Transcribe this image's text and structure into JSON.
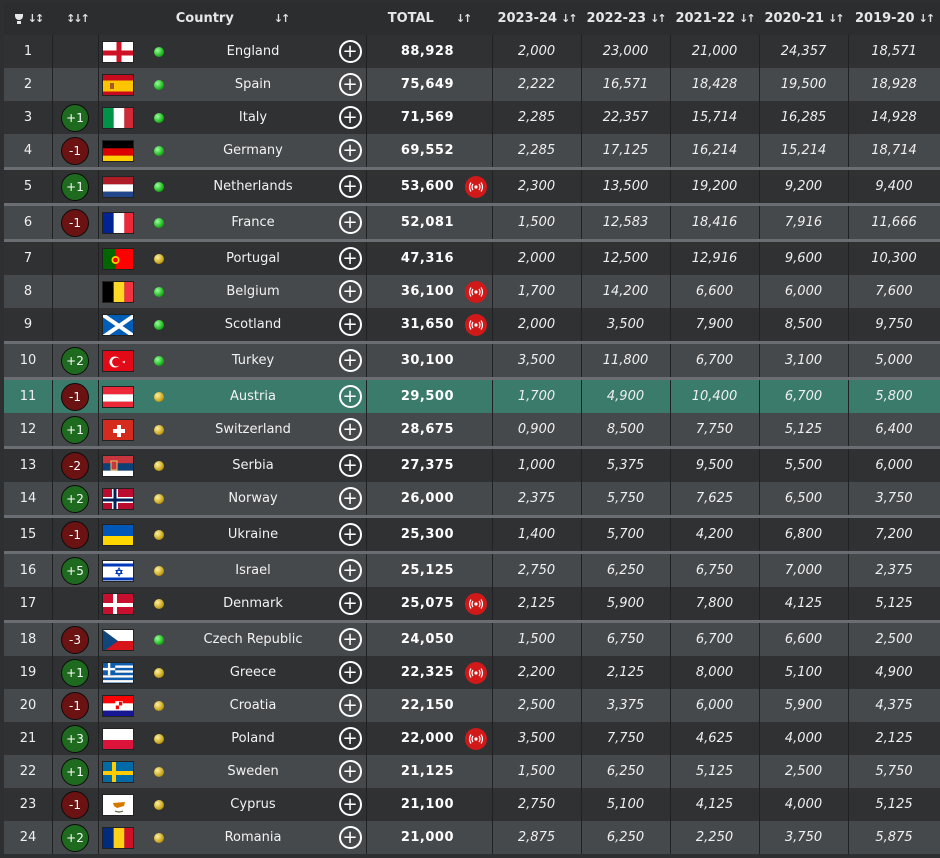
{
  "header": {
    "country": "Country",
    "total": "TOTAL",
    "seasons": [
      "2023-24",
      "2022-23",
      "2021-22",
      "2020-21",
      "2019-20"
    ]
  },
  "rows": [
    {
      "rank": "1",
      "change": "",
      "flag": "england",
      "status": "green",
      "country": "England",
      "total": "88,928",
      "live": false,
      "seasons": [
        "2,000",
        "23,000",
        "21,000",
        "24,357",
        "18,571"
      ]
    },
    {
      "rank": "2",
      "change": "",
      "flag": "spain",
      "status": "green",
      "country": "Spain",
      "total": "75,649",
      "live": false,
      "seasons": [
        "2,222",
        "16,571",
        "18,428",
        "19,500",
        "18,928"
      ]
    },
    {
      "rank": "3",
      "change": "+1",
      "flag": "italy",
      "status": "green",
      "country": "Italy",
      "total": "71,569",
      "live": false,
      "seasons": [
        "2,285",
        "22,357",
        "15,714",
        "16,285",
        "14,928"
      ]
    },
    {
      "rank": "4",
      "change": "-1",
      "flag": "germany",
      "status": "green",
      "country": "Germany",
      "total": "69,552",
      "live": false,
      "seasons": [
        "2,285",
        "17,125",
        "16,214",
        "15,214",
        "18,714"
      ]
    },
    {
      "rank": "5",
      "change": "+1",
      "flag": "netherlands",
      "status": "green",
      "country": "Netherlands",
      "total": "53,600",
      "live": true,
      "seasons": [
        "2,300",
        "13,500",
        "19,200",
        "9,200",
        "9,400"
      ]
    },
    {
      "rank": "6",
      "change": "-1",
      "flag": "france",
      "status": "green",
      "country": "France",
      "total": "52,081",
      "live": false,
      "seasons": [
        "1,500",
        "12,583",
        "18,416",
        "7,916",
        "11,666"
      ]
    },
    {
      "rank": "7",
      "change": "",
      "flag": "portugal",
      "status": "yellow",
      "country": "Portugal",
      "total": "47,316",
      "live": false,
      "seasons": [
        "2,000",
        "12,500",
        "12,916",
        "9,600",
        "10,300"
      ]
    },
    {
      "rank": "8",
      "change": "",
      "flag": "belgium",
      "status": "green",
      "country": "Belgium",
      "total": "36,100",
      "live": true,
      "seasons": [
        "1,700",
        "14,200",
        "6,600",
        "6,000",
        "7,600"
      ]
    },
    {
      "rank": "9",
      "change": "",
      "flag": "scotland",
      "status": "green",
      "country": "Scotland",
      "total": "31,650",
      "live": true,
      "seasons": [
        "2,000",
        "3,500",
        "7,900",
        "8,500",
        "9,750"
      ]
    },
    {
      "rank": "10",
      "change": "+2",
      "flag": "turkey",
      "status": "green",
      "country": "Turkey",
      "total": "30,100",
      "live": false,
      "seasons": [
        "3,500",
        "11,800",
        "6,700",
        "3,100",
        "5,000"
      ]
    },
    {
      "rank": "11",
      "change": "-1",
      "flag": "austria",
      "status": "yellow",
      "country": "Austria",
      "total": "29,500",
      "live": false,
      "seasons": [
        "1,700",
        "4,900",
        "10,400",
        "6,700",
        "5,800"
      ]
    },
    {
      "rank": "12",
      "change": "+1",
      "flag": "switzerland",
      "status": "yellow",
      "country": "Switzerland",
      "total": "28,675",
      "live": false,
      "seasons": [
        "0,900",
        "8,500",
        "7,750",
        "5,125",
        "6,400"
      ]
    },
    {
      "rank": "13",
      "change": "-2",
      "flag": "serbia",
      "status": "yellow",
      "country": "Serbia",
      "total": "27,375",
      "live": false,
      "seasons": [
        "1,000",
        "5,375",
        "9,500",
        "5,500",
        "6,000"
      ]
    },
    {
      "rank": "14",
      "change": "+2",
      "flag": "norway",
      "status": "yellow",
      "country": "Norway",
      "total": "26,000",
      "live": false,
      "seasons": [
        "2,375",
        "5,750",
        "7,625",
        "6,500",
        "3,750"
      ]
    },
    {
      "rank": "15",
      "change": "-1",
      "flag": "ukraine",
      "status": "yellow",
      "country": "Ukraine",
      "total": "25,300",
      "live": false,
      "seasons": [
        "1,400",
        "5,700",
        "4,200",
        "6,800",
        "7,200"
      ]
    },
    {
      "rank": "16",
      "change": "+5",
      "flag": "israel",
      "status": "yellow",
      "country": "Israel",
      "total": "25,125",
      "live": false,
      "seasons": [
        "2,750",
        "6,250",
        "6,750",
        "7,000",
        "2,375"
      ]
    },
    {
      "rank": "17",
      "change": "",
      "flag": "denmark",
      "status": "yellow",
      "country": "Denmark",
      "total": "25,075",
      "live": true,
      "seasons": [
        "2,125",
        "5,900",
        "7,800",
        "4,125",
        "5,125"
      ]
    },
    {
      "rank": "18",
      "change": "-3",
      "flag": "czech",
      "status": "green",
      "country": "Czech Republic",
      "total": "24,050",
      "live": false,
      "seasons": [
        "1,500",
        "6,750",
        "6,700",
        "6,600",
        "2,500"
      ]
    },
    {
      "rank": "19",
      "change": "+1",
      "flag": "greece",
      "status": "yellow",
      "country": "Greece",
      "total": "22,325",
      "live": true,
      "seasons": [
        "2,200",
        "2,125",
        "8,000",
        "5,100",
        "4,900"
      ]
    },
    {
      "rank": "20",
      "change": "-1",
      "flag": "croatia",
      "status": "yellow",
      "country": "Croatia",
      "total": "22,150",
      "live": false,
      "seasons": [
        "2,500",
        "3,375",
        "6,000",
        "5,900",
        "4,375"
      ]
    },
    {
      "rank": "21",
      "change": "+3",
      "flag": "poland",
      "status": "yellow",
      "country": "Poland",
      "total": "22,000",
      "live": true,
      "seasons": [
        "3,500",
        "7,750",
        "4,625",
        "4,000",
        "2,125"
      ]
    },
    {
      "rank": "22",
      "change": "+1",
      "flag": "sweden",
      "status": "yellow",
      "country": "Sweden",
      "total": "21,125",
      "live": false,
      "seasons": [
        "1,500",
        "6,250",
        "5,125",
        "2,500",
        "5,750"
      ]
    },
    {
      "rank": "23",
      "change": "-1",
      "flag": "cyprus",
      "status": "yellow",
      "country": "Cyprus",
      "total": "21,100",
      "live": false,
      "seasons": [
        "2,750",
        "5,100",
        "4,125",
        "4,000",
        "5,125"
      ]
    },
    {
      "rank": "24",
      "change": "+2",
      "flag": "romania",
      "status": "yellow",
      "country": "Romania",
      "total": "21,000",
      "live": false,
      "seasons": [
        "2,875",
        "6,250",
        "2,250",
        "3,750",
        "5,875"
      ]
    }
  ],
  "highlighted_rank": "11",
  "colors": {
    "status_green": "#1fb81f",
    "status_yellow": "#c9a61b",
    "badge_up": "#1e6a1e",
    "badge_down": "#6b1212",
    "highlight_row": "#3b7b6c",
    "live_icon": "#d11919"
  },
  "icons": {
    "rank_sort": "trophy-sort-icon",
    "change_sort": "sort-arrows-icon",
    "add": "plus-circle-icon",
    "live": "live-broadcast-icon"
  }
}
